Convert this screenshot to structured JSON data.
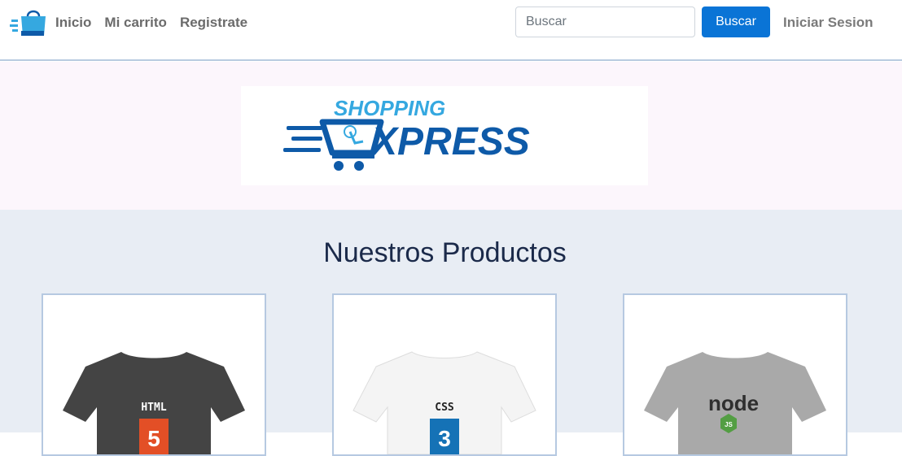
{
  "navbar": {
    "brand_icon": "shopping-bag-icon",
    "links": [
      {
        "label": "Inicio"
      },
      {
        "label": "Mi carrito"
      },
      {
        "label": "Registrate"
      }
    ],
    "search": {
      "placeholder": "Buscar",
      "value": ""
    },
    "search_button_label": "Buscar",
    "login_label": "Iniciar Sesion"
  },
  "hero": {
    "logo": {
      "text_top": "SHOPPING",
      "text_bottom": "XPRESS"
    }
  },
  "products": {
    "title": "Nuestros Productos",
    "items": [
      {
        "shirt_color": "#444444",
        "print": "HTML",
        "badge": "5",
        "badge_color": "#e34f26"
      },
      {
        "shirt_color": "#f4f4f4",
        "print": "CSS",
        "badge": "3",
        "badge_color": "#1572b6"
      },
      {
        "shirt_color": "#a9a9a9",
        "print": "node",
        "badge": "JS",
        "badge_color": "#539e43"
      }
    ]
  },
  "colors": {
    "accent": "#0a74d6",
    "logo_light_blue": "#35a8e0",
    "logo_dark_blue": "#0e5aa8"
  }
}
